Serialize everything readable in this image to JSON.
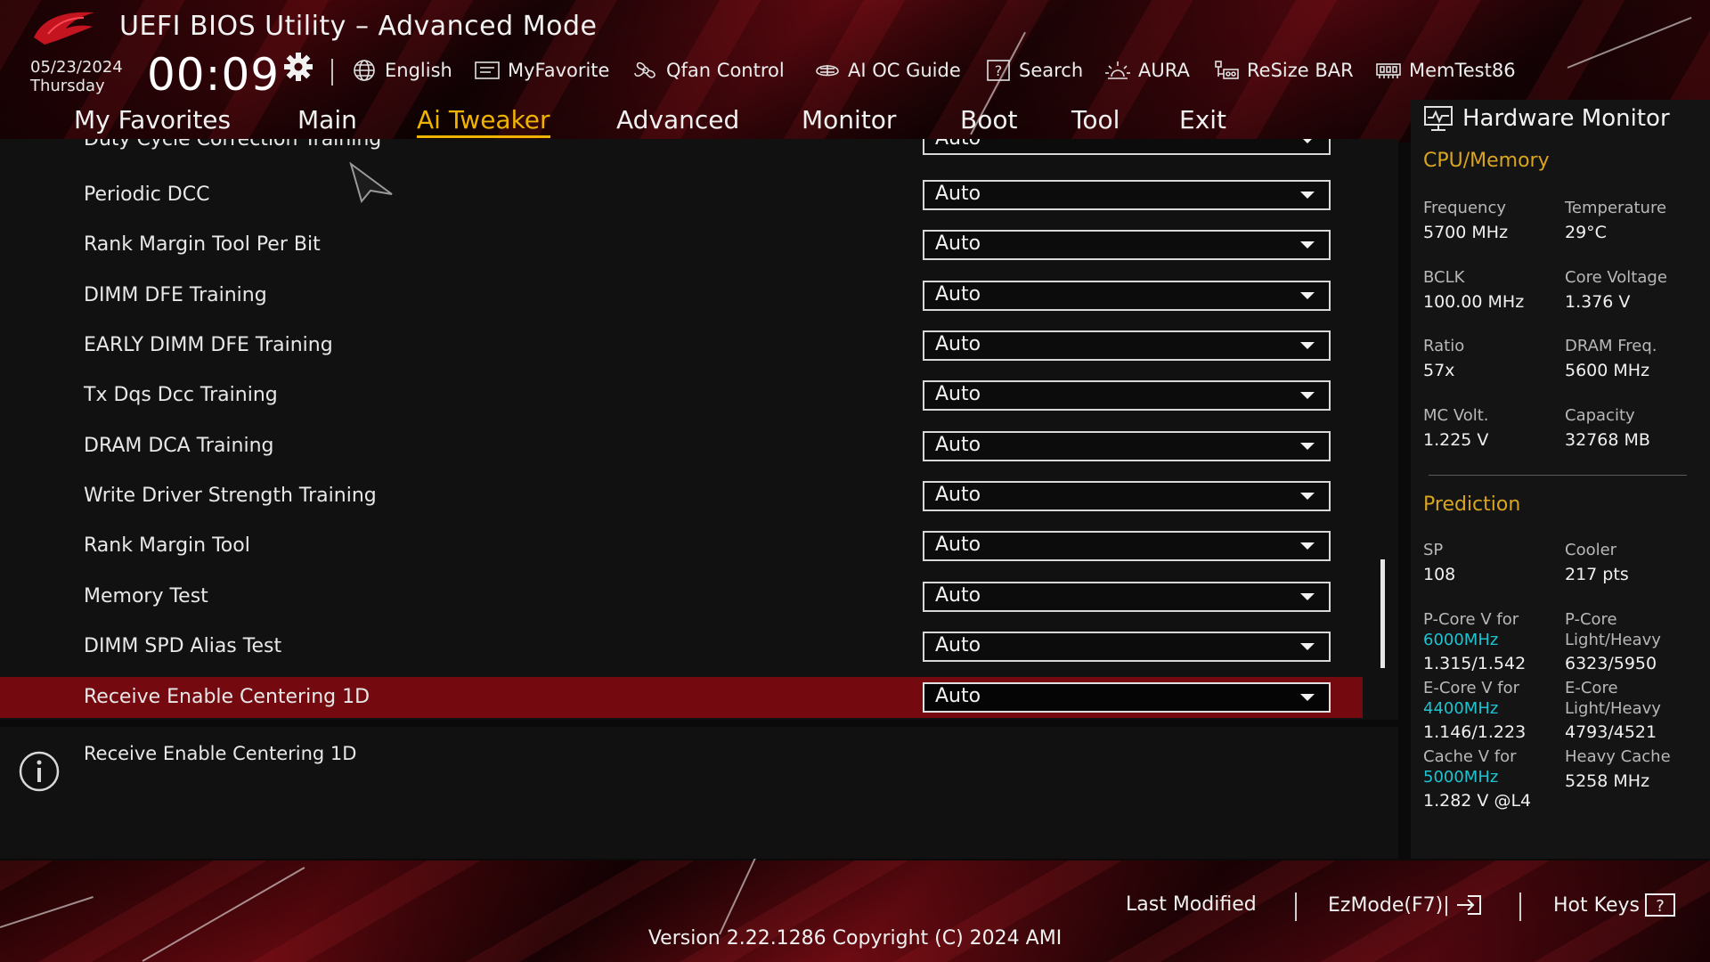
{
  "header": {
    "title": "UEFI BIOS Utility – Advanced Mode",
    "date": "05/23/2024",
    "day": "Thursday",
    "time": "00:09",
    "toolbar": [
      {
        "label": "English",
        "icon": "globe-icon"
      },
      {
        "label": "MyFavorite",
        "icon": "favorite-icon"
      },
      {
        "label": "Qfan Control",
        "icon": "fan-icon"
      },
      {
        "label": "AI OC Guide",
        "icon": "ai-oc-icon"
      },
      {
        "label": "Search",
        "icon": "search-icon"
      },
      {
        "label": "AURA",
        "icon": "aura-icon"
      },
      {
        "label": "ReSize BAR",
        "icon": "resize-bar-icon"
      },
      {
        "label": "MemTest86",
        "icon": "memtest-icon"
      }
    ]
  },
  "nav": {
    "tabs": [
      "My Favorites",
      "Main",
      "Ai Tweaker",
      "Advanced",
      "Monitor",
      "Boot",
      "Tool",
      "Exit"
    ],
    "active": "Ai Tweaker"
  },
  "settings": {
    "partial_label": "Duty Cycle Correction Training",
    "partial_value": "Auto",
    "rows": [
      {
        "label": "Periodic DCC",
        "value": "Auto"
      },
      {
        "label": "Rank Margin Tool Per Bit",
        "value": "Auto"
      },
      {
        "label": "DIMM DFE Training",
        "value": "Auto"
      },
      {
        "label": "EARLY DIMM DFE Training",
        "value": "Auto"
      },
      {
        "label": "Tx Dqs Dcc Training",
        "value": "Auto"
      },
      {
        "label": "DRAM DCA Training",
        "value": "Auto"
      },
      {
        "label": "Write Driver Strength Training",
        "value": "Auto"
      },
      {
        "label": "Rank Margin Tool",
        "value": "Auto"
      },
      {
        "label": "Memory Test",
        "value": "Auto"
      },
      {
        "label": "DIMM SPD Alias Test",
        "value": "Auto"
      },
      {
        "label": "Receive Enable Centering 1D",
        "value": "Auto"
      }
    ],
    "selected_index": 10
  },
  "info": {
    "text": "Receive Enable Centering 1D"
  },
  "hardware_monitor": {
    "title": "Hardware Monitor",
    "cpu_memory": {
      "heading": "CPU/Memory",
      "items": [
        {
          "label": "Frequency",
          "value": "5700 MHz"
        },
        {
          "label": "Temperature",
          "value": "29°C"
        },
        {
          "label": "BCLK",
          "value": "100.00 MHz"
        },
        {
          "label": "Core Voltage",
          "value": "1.376 V"
        },
        {
          "label": "Ratio",
          "value": "57x"
        },
        {
          "label": "DRAM Freq.",
          "value": "5600 MHz"
        },
        {
          "label": "MC Volt.",
          "value": "1.225 V"
        },
        {
          "label": "Capacity",
          "value": "32768 MB"
        }
      ]
    },
    "prediction": {
      "heading": "Prediction",
      "sp_label": "SP",
      "sp_value": "108",
      "cooler_label": "Cooler",
      "cooler_value": "217 pts",
      "pcore_v_label": "P-Core V for",
      "pcore_v_freq": "6000MHz",
      "pcore_v_value": "1.315/1.542",
      "pcore_lh_label1": "P-Core",
      "pcore_lh_label2": "Light/Heavy",
      "pcore_lh_value": "6323/5950",
      "ecore_v_label": "E-Core V for",
      "ecore_v_freq": "4400MHz",
      "ecore_v_value": "1.146/1.223",
      "ecore_lh_label1": "E-Core",
      "ecore_lh_label2": "Light/Heavy",
      "ecore_lh_value": "4793/4521",
      "cache_v_label": "Cache V for",
      "cache_v_freq": "5000MHz",
      "cache_v_value": "1.282 V @L4",
      "heavy_cache_label": "Heavy Cache",
      "heavy_cache_value": "5258 MHz"
    }
  },
  "footer": {
    "last_modified": "Last Modified",
    "ezmode": "EzMode(F7)|",
    "hotkeys": "Hot Keys",
    "hotkeys_key": "?",
    "version": "Version 2.22.1286 Copyright (C) 2024 AMI"
  },
  "colors": {
    "accent": "#f0b400",
    "section_heading": "#d9a521",
    "frequency_highlight": "#1fc3d0",
    "selected_row": "#740a0f"
  }
}
